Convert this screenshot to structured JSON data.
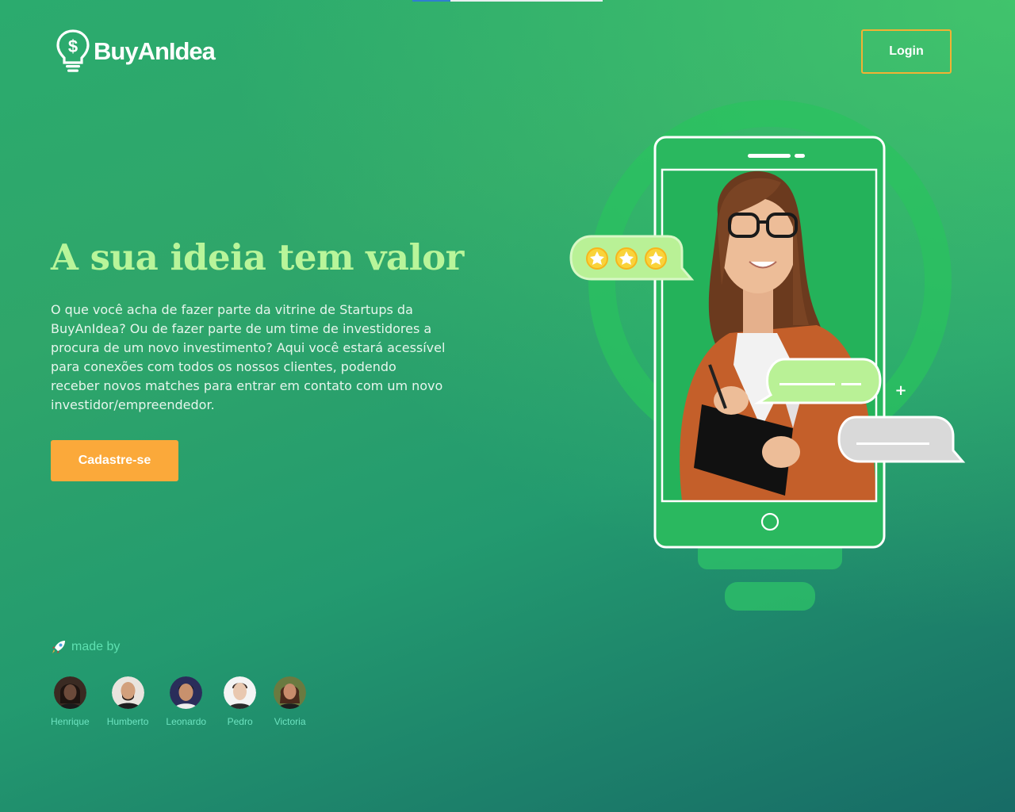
{
  "brand": {
    "name_bold_1": "BuyAn",
    "name_thin": "",
    "name_full": "BuyAnIdea",
    "icon": "lightbulb-dollar-icon"
  },
  "header": {
    "login_label": "Login"
  },
  "hero": {
    "title": "A sua ideia tem valor",
    "description": "O que você acha de fazer parte da vitrine de Startups da BuyAnIdea? Ou de fazer parte de um time de investidores a procura de um novo investimento? Aqui você estará acessível para conexões com todos os nossos clientes, podendo receber novos matches para entrar em contato com um novo investidor/empreendedor.",
    "cta_label": "Cadastre-se"
  },
  "footer": {
    "made_by_label": "made by",
    "made_by_icon": "rocket-icon",
    "team": [
      {
        "name": "Henrique",
        "skin": "#6b4a3a",
        "hair": "#1e1410",
        "bg": "#3a2a22"
      },
      {
        "name": "Humberto",
        "skin": "#d2a07c",
        "hair": "#2a1f1a",
        "bg": "#e9e4de"
      },
      {
        "name": "Leonardo",
        "skin": "#c8916d",
        "hair": "#1c1a24",
        "bg": "#2a2d5a"
      },
      {
        "name": "Pedro",
        "skin": "#e9c8b0",
        "hair": "#3a2c26",
        "bg": "#f4f4f4"
      },
      {
        "name": "Victoria",
        "skin": "#c88c6c",
        "hair": "#4a2a1c",
        "bg": "#6a7a40"
      }
    ]
  },
  "colors": {
    "accent_orange": "#fba93a",
    "title_green": "#b8f59a",
    "login_border": "#f2b233"
  }
}
